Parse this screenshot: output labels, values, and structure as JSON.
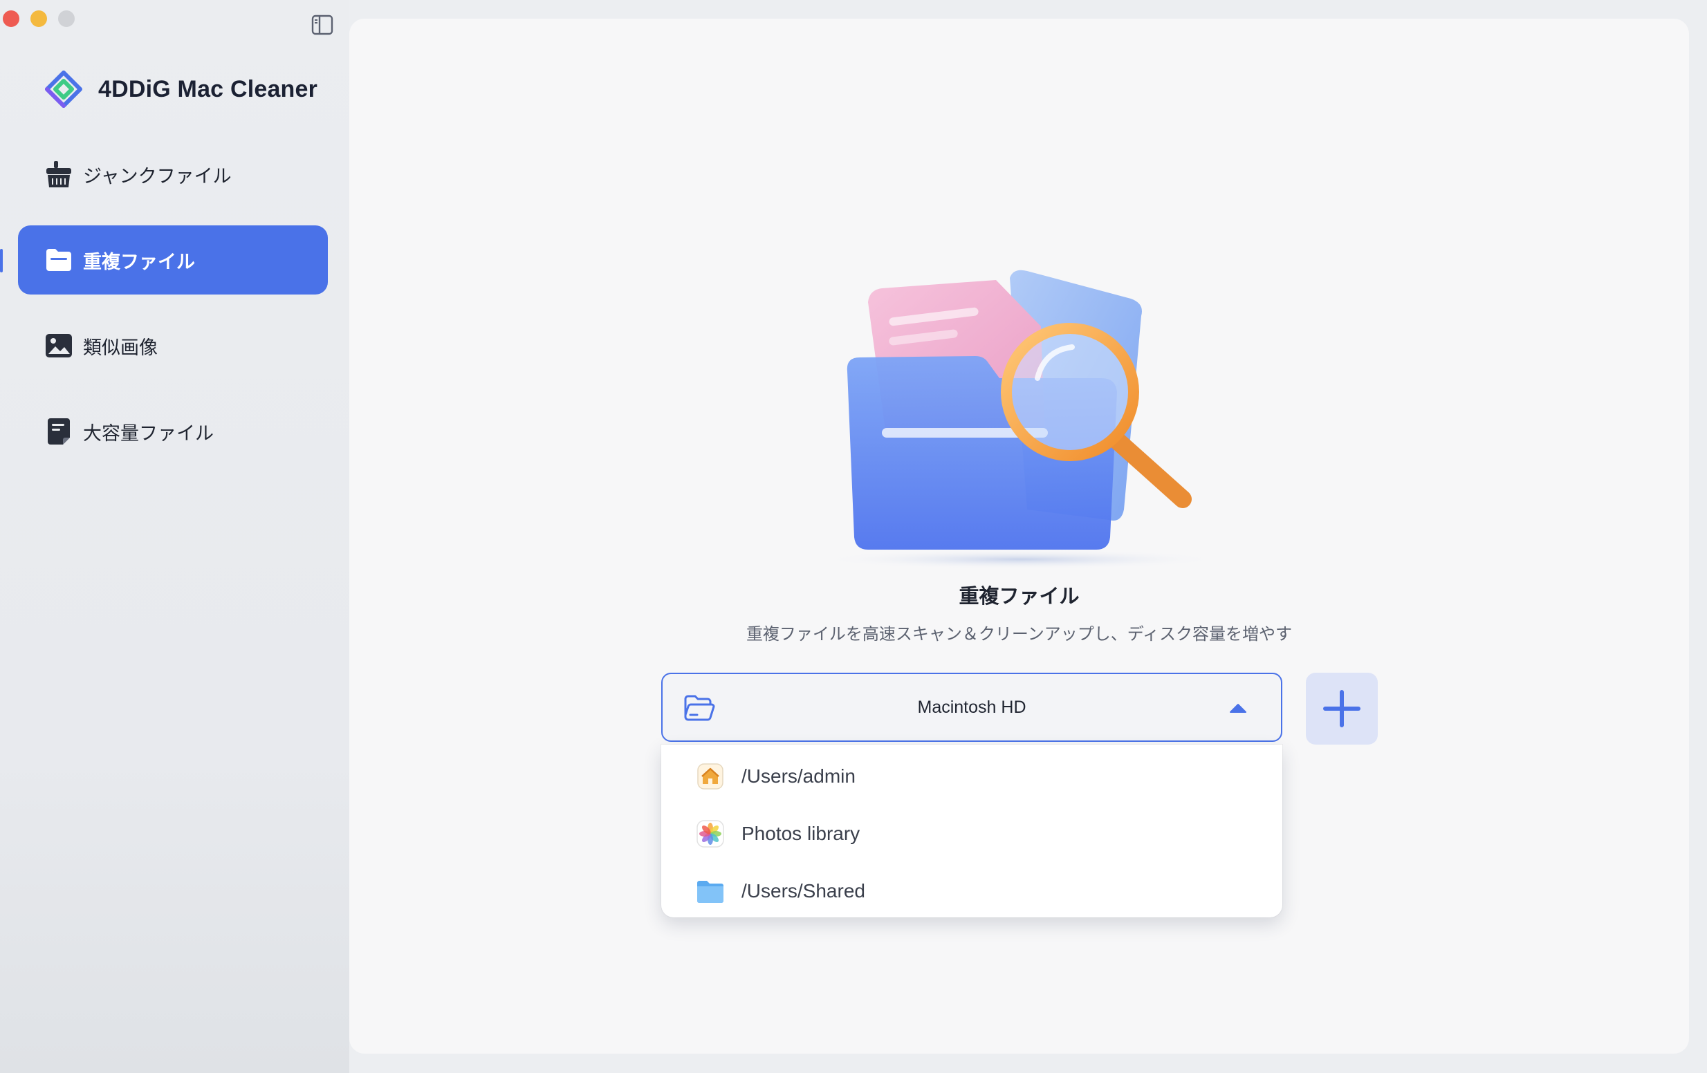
{
  "app": {
    "name": "4DDiG Mac Cleaner"
  },
  "sidebar": {
    "items": [
      {
        "label": "ジャンクファイル",
        "icon": "broom-icon"
      },
      {
        "label": "重複ファイル",
        "icon": "folder-icon",
        "active": true
      },
      {
        "label": "類似画像",
        "icon": "image-icon"
      },
      {
        "label": "大容量ファイル",
        "icon": "large-file-icon"
      }
    ]
  },
  "main": {
    "title": "重複ファイル",
    "subtitle": "重複ファイルを高速スキャン＆クリーンアップし、ディスク容量を増やす",
    "location_select": {
      "value": "Macintosh HD",
      "options": [
        {
          "label": "/Users/admin",
          "icon": "home-icon"
        },
        {
          "label": "Photos library",
          "icon": "photos-icon"
        },
        {
          "label": "/Users/Shared",
          "icon": "folder-icon"
        }
      ]
    },
    "add_button_icon": "plus-icon"
  },
  "colors": {
    "accent": "#4a72e8",
    "sidebar_bg": "#ebedf0",
    "main_bg": "#f7f7f8",
    "add_button_bg": "#dde3f7"
  }
}
